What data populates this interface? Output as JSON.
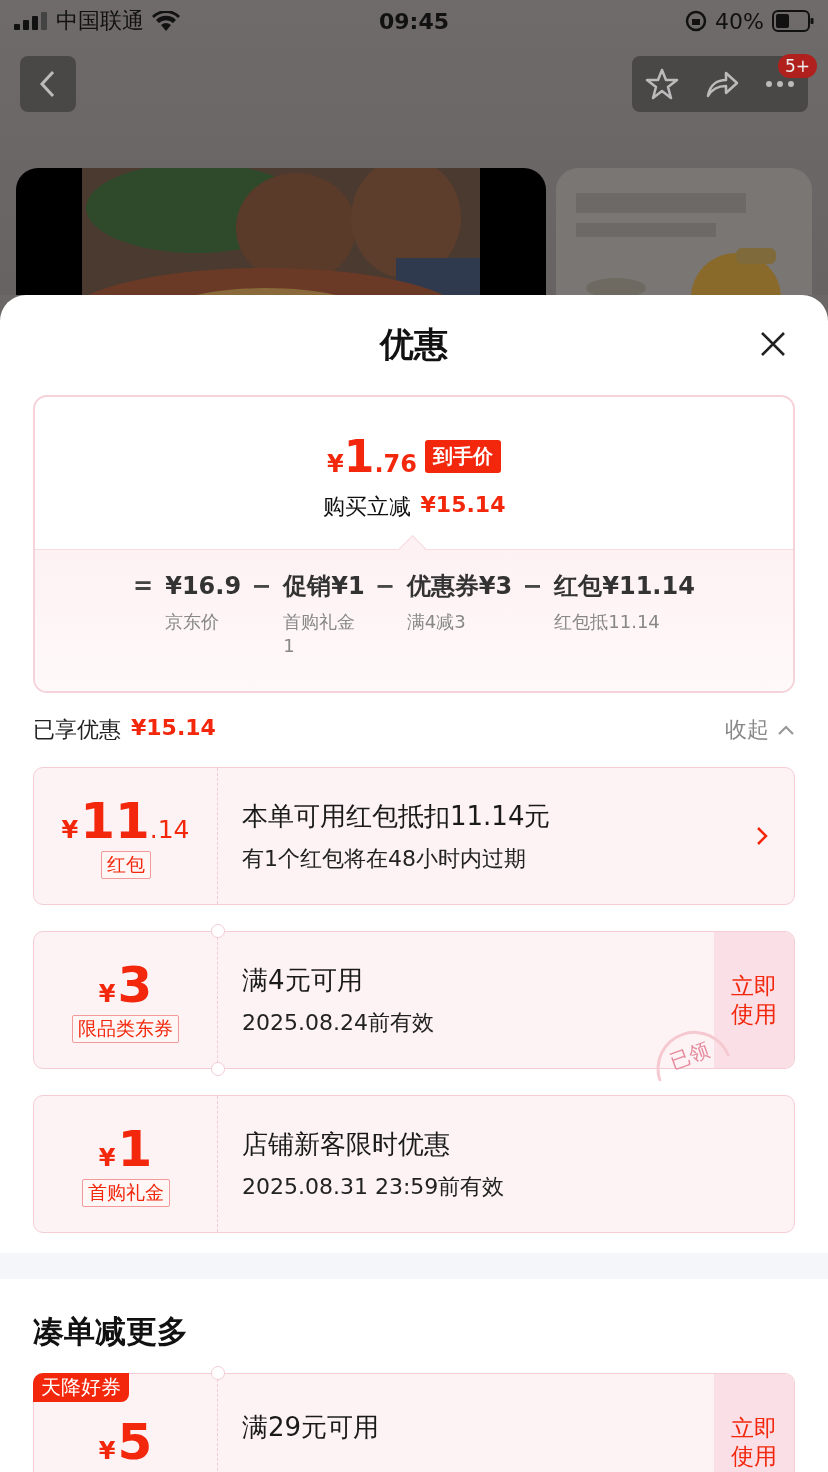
{
  "status_bar": {
    "carrier": "中国联通",
    "time": "09:45",
    "battery": "40%"
  },
  "nav": {
    "badge": "5+"
  },
  "sheet": {
    "title": "优惠"
  },
  "summary": {
    "currency": "¥",
    "integer": "1",
    "decimal": ".76",
    "tag": "到手价",
    "reduction_label": "购买立减",
    "reduction_amount": "¥15.14",
    "terms": [
      {
        "operator": "=",
        "value": "¥16.9",
        "note": "京东价"
      },
      {
        "operator": "−",
        "value": "促销¥1",
        "note": "首购礼金1"
      },
      {
        "operator": "−",
        "value": "优惠券¥3",
        "note": "满4减3"
      },
      {
        "operator": "−",
        "value": "红包¥11.14",
        "note": "红包抵11.14"
      }
    ]
  },
  "applied": {
    "label": "已享优惠",
    "amount": "¥15.14",
    "toggle": "收起",
    "expanded": true
  },
  "coupons": [
    {
      "kind": "redpacket",
      "currency": "¥",
      "integer": "11",
      "decimal": ".14",
      "tag": "红包",
      "title": "本单可用红包抵扣11.14元",
      "subtitle": "有1个红包将在48小时内过期"
    },
    {
      "kind": "coupon",
      "currency": "¥",
      "integer": "3",
      "tag": "限品类东券",
      "title": "满4元可用",
      "subtitle": "2025.08.24前有效",
      "action": "立即使用",
      "stamp": "已领"
    },
    {
      "kind": "gift",
      "currency": "¥",
      "integer": "1",
      "tag": "首购礼金",
      "title": "店铺新客限时优惠",
      "subtitle": "2025.08.31 23:59前有效"
    }
  ],
  "more": {
    "title": "凑单减更多",
    "coupons": [
      {
        "kind": "coupon",
        "ribbon": "天降好券",
        "currency": "¥",
        "integer": "5",
        "title": "满29元可用",
        "action": "立即使用"
      }
    ]
  }
}
